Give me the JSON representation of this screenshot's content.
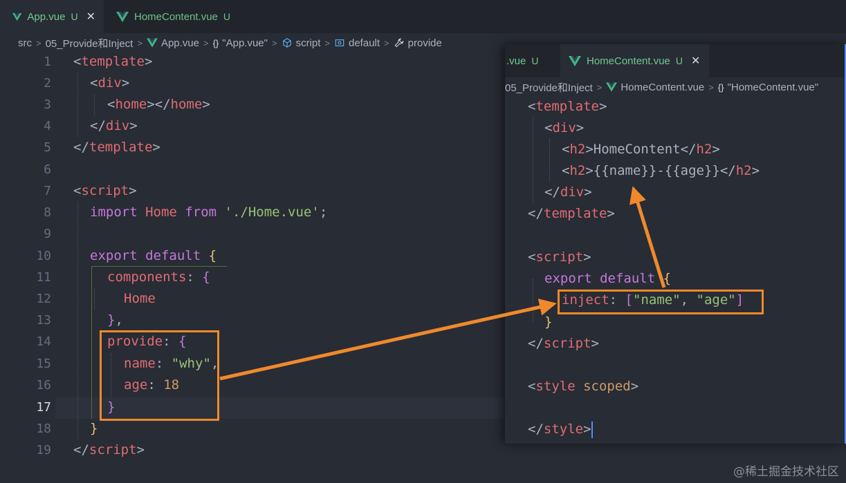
{
  "left": {
    "tabs": [
      {
        "label": "App.vue",
        "status": "U"
      },
      {
        "label": "HomeContent.vue",
        "status": "U"
      }
    ],
    "breadcrumb": [
      "src",
      "05_Provide和Inject",
      "App.vue",
      "\"App.vue\"",
      "script",
      "default",
      "provide"
    ],
    "line_numbers": [
      "1",
      "2",
      "3",
      "4",
      "5",
      "6",
      "7",
      "8",
      "9",
      "10",
      "11",
      "12",
      "13",
      "14",
      "15",
      "16",
      "17",
      "18",
      "19"
    ]
  },
  "right": {
    "tabs": [
      {
        "label": ".vue",
        "status": "U"
      },
      {
        "label": "HomeContent.vue",
        "status": "U"
      }
    ],
    "breadcrumb": [
      "05_Provide和Inject",
      "HomeContent.vue",
      "\"HomeContent.vue\""
    ]
  },
  "code_text": {
    "template_open": "template",
    "template_close": "template",
    "div": "div",
    "home": "home",
    "script": "script",
    "import": "import",
    "Home": "Home",
    "from": "from",
    "import_path": "'./Home.vue'",
    "export": "export",
    "default": "default",
    "components": "components",
    "provide": "provide",
    "name": "name",
    "why": "\"why\"",
    "age": "age",
    "age_val": "18",
    "h2": "h2",
    "HomeContent": "HomeContent",
    "mustache_name": "{{name}}",
    "dash": "-",
    "mustache_age": "{{age}}",
    "inject": "inject",
    "inject_name": "\"name\"",
    "inject_age": "\"age\"",
    "style": "style",
    "scoped": "scoped"
  },
  "watermark": "@稀土掘金技术社区",
  "colors": {
    "annotation": "#f0892c",
    "vue_green": "#41b883",
    "tag": "#e06c75",
    "keyword": "#c678dd",
    "string": "#98c379"
  },
  "icons": [
    "vue-icon",
    "close-icon",
    "braces-icon",
    "cube-icon",
    "symbol-icon",
    "wrench-icon",
    "chevron-right-icon"
  ]
}
